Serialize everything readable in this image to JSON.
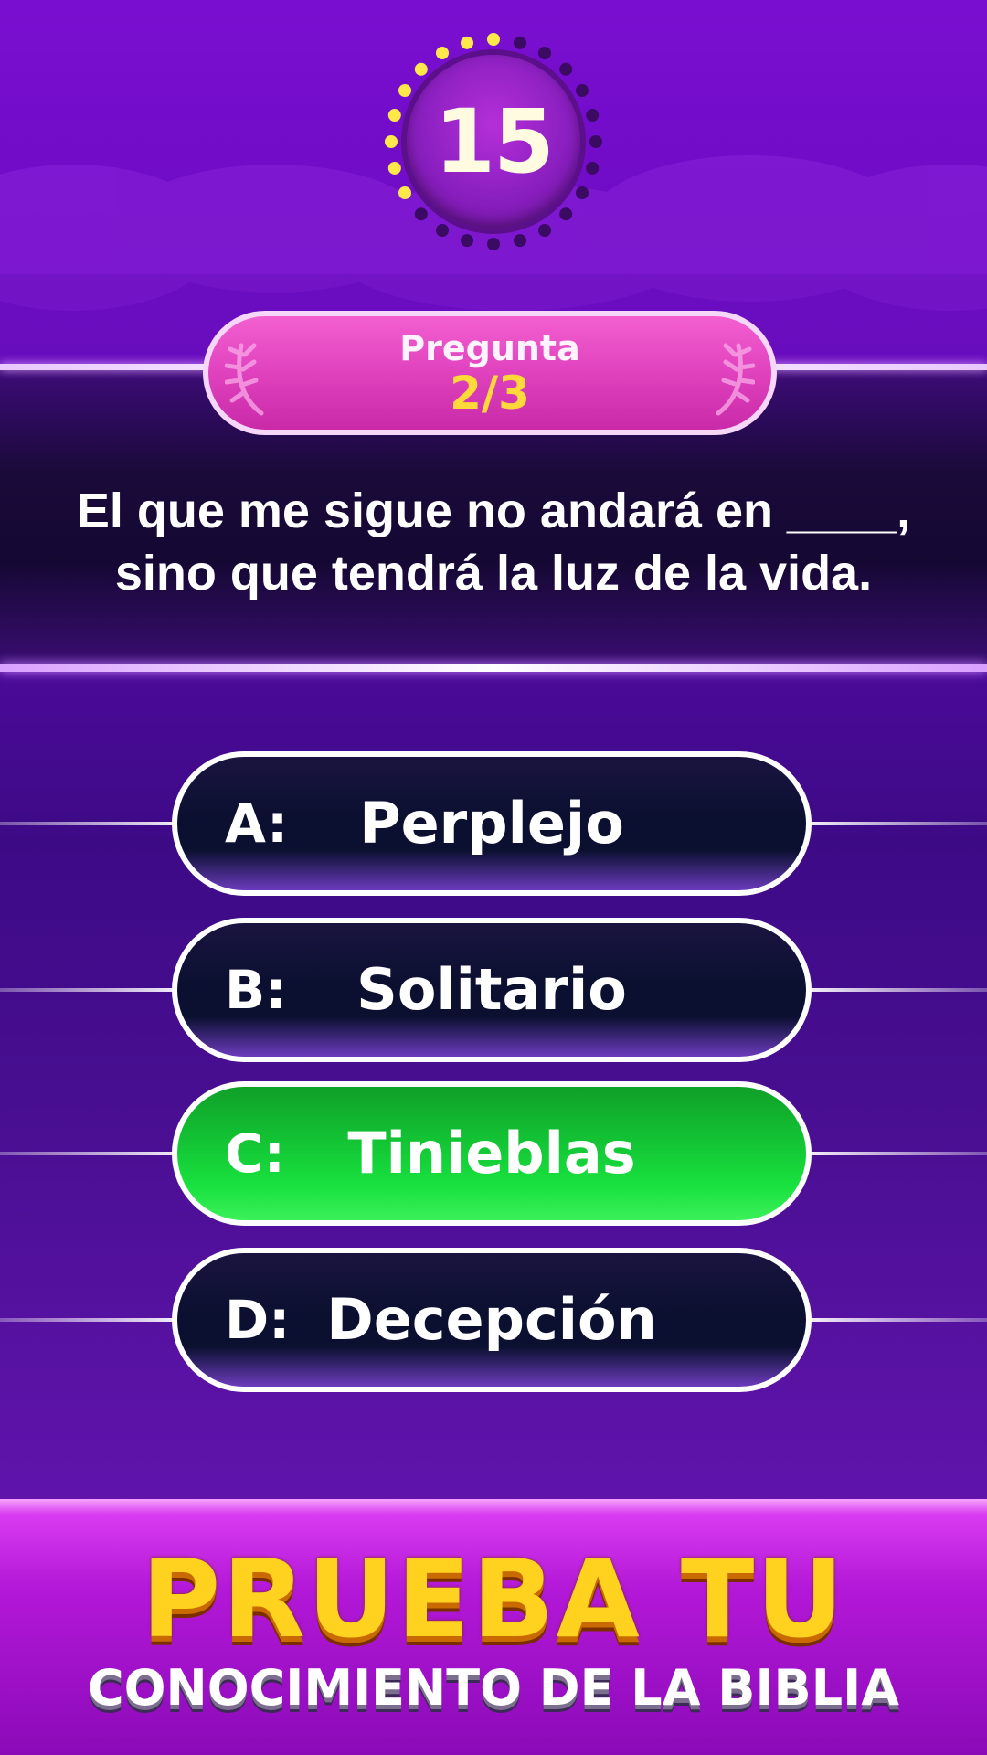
{
  "timer": {
    "value": "15",
    "dots_total": 24,
    "dots_elapsed": 9,
    "dot_color_active": "#ffe84a",
    "dot_color_inactive": "#3b0a63"
  },
  "question_badge": {
    "label": "Pregunta",
    "count": "2/3"
  },
  "question": {
    "line1": "El que me sigue no andará en ____,",
    "line2": "sino que tendrá la luz de la vida."
  },
  "answers": [
    {
      "letter": "A:",
      "text": "Perplejo",
      "state": "default"
    },
    {
      "letter": "B:",
      "text": "Solitario",
      "state": "default"
    },
    {
      "letter": "C:",
      "text": "Tinieblas",
      "state": "correct"
    },
    {
      "letter": "D:",
      "text": "Decepción",
      "state": "default"
    }
  ],
  "promo": {
    "line1": "PRUEBA TU",
    "line2": "CONOCIMIENTO DE LA BIBLIA"
  },
  "colors": {
    "correct": "#19e23f",
    "badge": "#e042be",
    "count": "#ffd93a",
    "headline": "#ffd21f"
  }
}
